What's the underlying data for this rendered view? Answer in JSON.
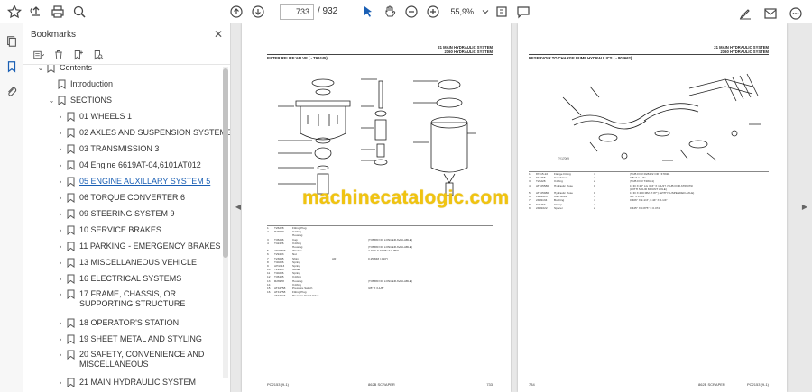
{
  "toolbar": {
    "page_current": "733",
    "page_total": "/ 932",
    "zoom": "55,9%"
  },
  "panel": {
    "title": "Bookmarks",
    "items": [
      {
        "label": "Contents"
      },
      {
        "label": "Introduction"
      },
      {
        "label": "SECTIONS"
      },
      {
        "label": "01 WHEELS 1"
      },
      {
        "label": "02 AXLES AND SUSPENSION SYSTEMS 2"
      },
      {
        "label": "03 TRANSMISSION 3"
      },
      {
        "label": "04 Engine 6619AT-04,6101AT012"
      },
      {
        "label": "05 ENGINE AUXILLARY SYSTEM 5"
      },
      {
        "label": "06 TORQUE CONVERTER 6"
      },
      {
        "label": "09 STEERING SYSTEM 9"
      },
      {
        "label": "10 SERVICE BRAKES"
      },
      {
        "label": "11 PARKING - EMERGENCY BRAKES"
      },
      {
        "label": "13 MISCELLANEOUS VEHICLE"
      },
      {
        "label": "16 ELECTRICAL SYSTEMS"
      },
      {
        "label": "17 FRAME, CHASSIS, OR SUPPORTING STRUCTURE"
      },
      {
        "label": "18 OPERATOR'S STATION"
      },
      {
        "label": "19 SHEET METAL AND STYLING"
      },
      {
        "label": "20 SAFETY, CONVENIENCE AND MISCELLANEOUS"
      },
      {
        "label": "21 MAIN HYDRAULIC SYSTEM"
      }
    ]
  },
  "left_page": {
    "header_line1": "21 MAIN HYDRAULIC SYSTEM",
    "header_line2": "2160 HYDRAULIC SYSTEM",
    "title": "FILTER RELIEF VALVE ( - T92445)",
    "footer_left": "PC2153   (9-1)",
    "footer_mid": "862B SCRAPER",
    "footer_right": "733"
  },
  "right_page": {
    "header_line1": "21 MAIN HYDRAULIC SYSTEM",
    "header_line2": "2160 HYDRAULIC SYSTEM",
    "title": "RESERVOIR TO CHARGE PUMP HYDRAULICS ( - 803662)",
    "figure_label": "TY17069",
    "footer_left": "734",
    "footer_mid": "862B SCRAPER",
    "footer_right": "PC2153   (9-1)"
  },
  "left_table": [
    [
      "1",
      "T26228",
      "Fitting Plug",
      "",
      ""
    ],
    [
      "2",
      "R26926",
      "O-Ring",
      "",
      ""
    ],
    [
      "",
      "",
      "Housing",
      "",
      ""
    ],
    [
      "3",
      "T45246",
      "Cap",
      "",
      "(T45380 NO LONGER AVAILABLE)"
    ],
    [
      "4",
      "T42426",
      "O-Ring",
      "",
      ""
    ],
    [
      "",
      "",
      "Housing",
      "",
      "(T45380 NO LONGER AVAILABLE)"
    ],
    [
      "5",
      "24H1896",
      "Washer",
      "",
      "4.162\" X 19.75\" X 0.050\""
    ],
    [
      "6",
      "T29403",
      "Nut",
      "",
      ""
    ],
    [
      "7",
      "T23045",
      "Shim",
      "AR",
      "0.25 MM (.010\")"
    ],
    [
      "8",
      "T40206",
      "Spring",
      "",
      ""
    ],
    [
      "9",
      "AH1313",
      "Spring",
      "",
      ""
    ],
    [
      "10",
      "T29405",
      "Guide",
      "",
      ""
    ],
    [
      "11",
      "T40206",
      "Spring",
      "",
      ""
    ],
    [
      "12",
      "T45405",
      "O-Ring",
      "",
      ""
    ],
    [
      "13",
      "R26978",
      "Housing",
      "",
      "(T45380 NO LONGER AVAILABLE)"
    ],
    [
      "14",
      "",
      "O-Ring",
      "",
      ""
    ],
    [
      "15",
      "AT42758",
      "Pressure Switch",
      "",
      "3/8\" X 3-1/8\""
    ],
    [
      "16",
      "AT41758",
      "Fitting Plug",
      "",
      ""
    ],
    [
      "",
      "AT42243",
      "Pressure Relief Valve",
      "",
      ""
    ]
  ],
  "right_table": [
    [
      "1",
      "87315-22",
      "Flange Fitting",
      "4",
      "(SUB FOR R28422 OR T47840)"
    ],
    [
      "2",
      "T18468",
      "Cap Screw",
      "4",
      "3/8\" X 1-1/4\""
    ],
    [
      "3",
      "T26228",
      "O-Ring",
      "2",
      "(SUB FOR T28431)"
    ],
    [
      "4",
      "AT105580",
      "Hydraulic Hose",
      "1",
      "1\" ID X 20\" LG (1.6\" X 1-1/2\") (SUB FOR AT69479)"
    ],
    [
      "",
      "",
      "",
      "",
      "(WITH SOLID MOUNT AXLE)"
    ],
    [
      "5",
      "AT105980",
      "Hydraulic Hose",
      "1",
      "1\" ID X 200 MM (7.87\") (WITH SUSPENDED AXLE)"
    ],
    [
      "6",
      "19H1623",
      "Cap Screw",
      "4",
      "3/8\" X 2-1/4\""
    ],
    [
      "7",
      "24H1134",
      "Bushing",
      "4",
      "0.406\" X 2-1/4\", 0.44\" X 2-1/4\""
    ],
    [
      "8",
      "T26463",
      "Clamp",
      "2",
      ""
    ],
    [
      "9",
      "24H1022",
      "Spacer",
      "2",
      "0.445\" X 0.875\" X 0.474\""
    ]
  ],
  "watermark": "machinecatalogic.com"
}
